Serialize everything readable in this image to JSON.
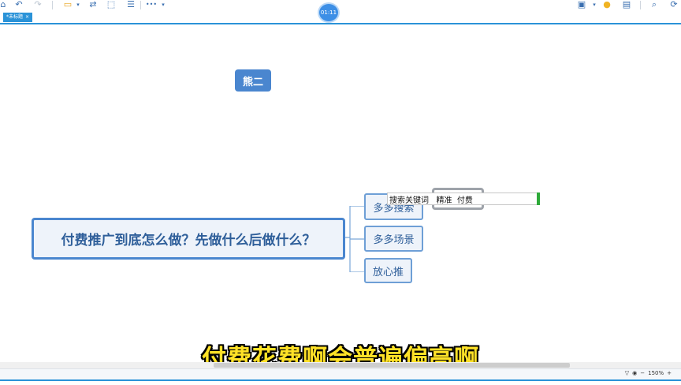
{
  "toolbar": {
    "icons": [
      "home-icon",
      "undo-icon",
      "redo-icon",
      "topic-icon",
      "dropdown-arrow-icon",
      "relationship-icon",
      "boundary-icon",
      "summary-icon",
      "more-icon",
      "dropdown-arrow-icon",
      "presentation-icon",
      "dropdown-arrow-icon",
      "lightbulb-icon",
      "outline-icon",
      "search-icon",
      "share-icon"
    ],
    "more_label": "•••",
    "timer": "01:11"
  },
  "tab": {
    "label": "*未标题",
    "close": "×"
  },
  "mindmap": {
    "floating_topic": "熊二",
    "central_topic": "付费推广到底怎么做？先做什么后做什么？",
    "children": [
      "多多搜索",
      "多多场景",
      "放心推"
    ],
    "edit_text": "搜索关键词   精准  付费"
  },
  "subtitle": "付费花费啊会普遍偏高啊",
  "status": {
    "zoom": "150%",
    "zoom_out": "−",
    "zoom_in": "+"
  },
  "colors": {
    "accent": "#2b93d8",
    "node_fill": "#4a86cf",
    "subtitle": "#ffe227"
  }
}
